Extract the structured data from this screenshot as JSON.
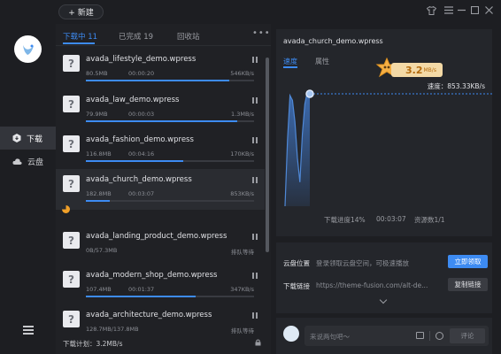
{
  "toolbar": {
    "new_label": "+ 新建"
  },
  "window_controls": [
    "shirt-icon",
    "menu-icon",
    "minimize-icon",
    "maximize-icon",
    "close-icon"
  ],
  "nav": {
    "items": [
      {
        "label": "下载",
        "icon": "download-icon"
      },
      {
        "label": "云盘",
        "icon": "cloud-icon"
      }
    ]
  },
  "tabs": {
    "downloading": "下载中",
    "downloading_count": "11",
    "done": "已完成",
    "done_count": "19",
    "trash": "回收站",
    "more": "•••"
  },
  "items": [
    {
      "name": "avada_lifestyle_demo.wpress",
      "size": "80.5MB",
      "time": "00:00:20",
      "speed": "546KB/s",
      "progress": 0.85
    },
    {
      "name": "avada_law_demo.wpress",
      "size": "79.9MB",
      "time": "00:00:03",
      "speed": "1.3MB/s",
      "progress": 0.9
    },
    {
      "name": "avada_fashion_demo.wpress",
      "size": "116.8MB",
      "time": "00:04:16",
      "speed": "170KB/s",
      "progress": 0.58
    },
    {
      "name": "avada_church_demo.wpress",
      "size": "182.8MB",
      "time": "00:03:07",
      "speed": "853KB/s",
      "progress": 0.14
    },
    {
      "name": "avada_landing_product_demo.wpress",
      "size": "0B/57.3MB",
      "time": "",
      "speed": "排队等待",
      "progress": 0
    },
    {
      "name": "avada_modern_shop_demo.wpress",
      "size": "107.4MB",
      "time": "00:01:37",
      "speed": "347KB/s",
      "progress": 0.65
    },
    {
      "name": "avada_architecture_demo.wpress",
      "size": "128.7MB/137.8MB",
      "time": "",
      "speed": "排队等待",
      "progress": 0.92
    }
  ],
  "list_footer": "下载计划：3.2MB/s",
  "detail": {
    "title": "avada_church_demo.wpress",
    "tab_speed": "速度",
    "tab_props": "属性",
    "badge_value": "3.2",
    "badge_unit": "MB/s",
    "speed_label": "速度：853.33KB/s",
    "progress_text": "下载进度14%",
    "time_text": "00:03:07",
    "resource_text": "资源数1/1"
  },
  "chart_data": {
    "type": "area",
    "title": "",
    "x": [
      0,
      1,
      2,
      3,
      4,
      5,
      6,
      7,
      8,
      9,
      10
    ],
    "values": [
      0,
      55,
      92,
      88,
      70,
      40,
      20,
      60,
      85,
      95,
      95
    ],
    "ylim": [
      0,
      100
    ],
    "series_color": "#3d8bf2"
  },
  "cloud": {
    "location_label": "云盘位置",
    "location_text": "登录领取云盘空间，可极速播放",
    "claim_button": "立即领取",
    "link_label": "下载链接",
    "link_text": "https://theme-fusion.com/alt-de...",
    "copy_button": "复制链接"
  },
  "comment": {
    "placeholder": "来说两句吧～",
    "send_button": "评论"
  },
  "colors": {
    "accent": "#3d8bf2",
    "badge": "#f3d9a6",
    "warning": "#f0a029"
  }
}
